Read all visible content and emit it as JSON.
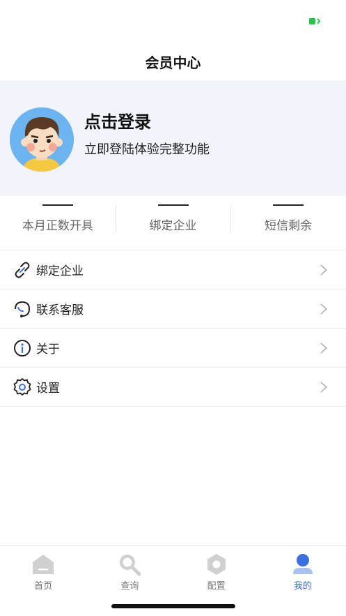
{
  "nav": {
    "title": "会员中心"
  },
  "profile": {
    "title": "点击登录",
    "subtitle": "立即登陆体验完整功能"
  },
  "stats": [
    {
      "value": "——",
      "label": "本月正数开具"
    },
    {
      "value": "——",
      "label": "绑定企业"
    },
    {
      "value": "——",
      "label": "短信剩余"
    }
  ],
  "menu": [
    {
      "label": "绑定企业",
      "icon": "link-icon"
    },
    {
      "label": "联系客服",
      "icon": "headset-icon"
    },
    {
      "label": "关于",
      "icon": "info-icon"
    },
    {
      "label": "设置",
      "icon": "gear-icon"
    }
  ],
  "tabs": [
    {
      "label": "首页",
      "icon": "home-icon",
      "active": false
    },
    {
      "label": "查询",
      "icon": "search-icon",
      "active": false
    },
    {
      "label": "配置",
      "icon": "config-icon",
      "active": false
    },
    {
      "label": "我的",
      "icon": "user-icon",
      "active": true
    }
  ],
  "colors": {
    "accent": "#3a6fe0",
    "profile_bg": "#f1f4fb",
    "battery": "#2bc24a"
  }
}
